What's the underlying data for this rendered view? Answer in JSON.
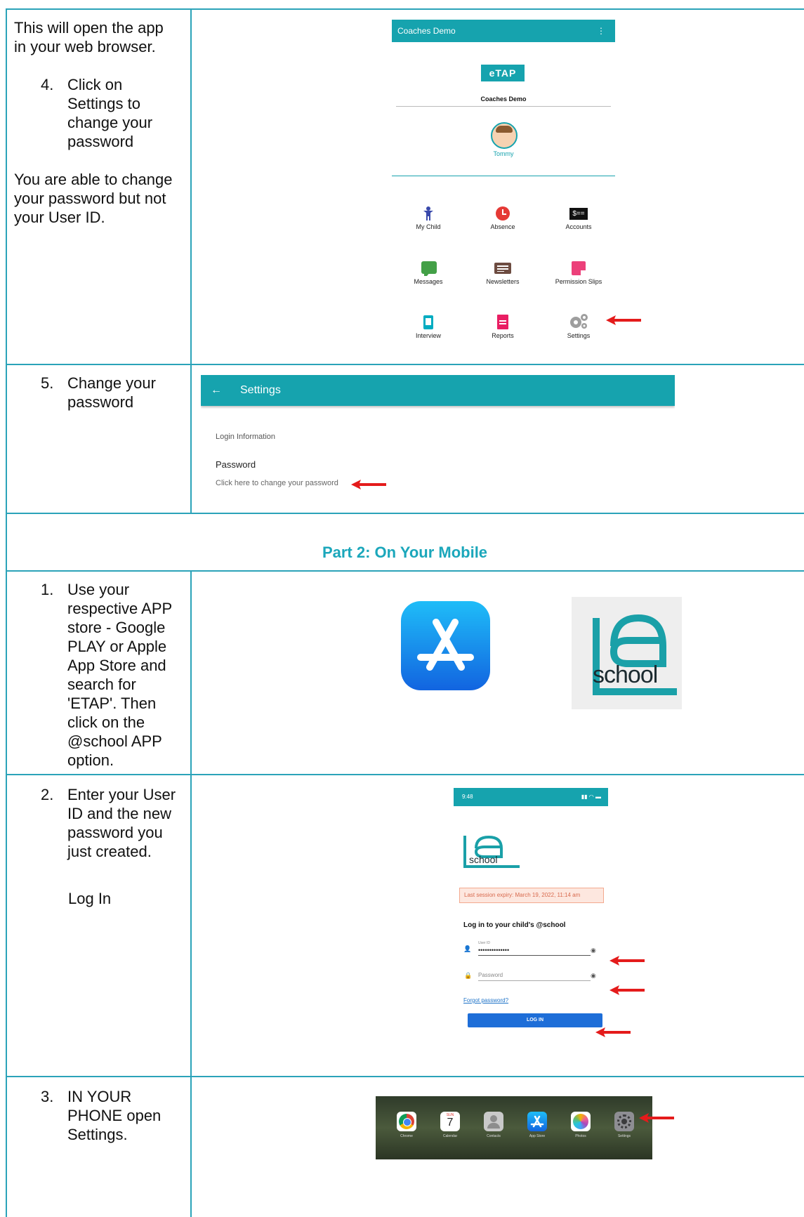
{
  "row1": {
    "intro": "This will open the app in your web browser.",
    "step_number": "4.",
    "step_text": "Click on Settings to change your password",
    "note": "You are able to change your password but not your User ID.",
    "app": {
      "header_title": "Coaches Demo",
      "menu_glyph": "⋮",
      "logo_text": "eTAP",
      "school_name": "Coaches Demo",
      "child_name": "Tommy",
      "tiles": [
        {
          "label": "My Child",
          "icon": "child-icon",
          "color": "#3949ab"
        },
        {
          "label": "Absence",
          "icon": "clock-icon",
          "color": "#e53935"
        },
        {
          "label": "Accounts",
          "icon": "money-icon",
          "color": "#111111"
        },
        {
          "label": "Messages",
          "icon": "chat-icon",
          "color": "#43a047"
        },
        {
          "label": "Newsletters",
          "icon": "newspaper-icon",
          "color": "#6d4c41"
        },
        {
          "label": "Permission Slips",
          "icon": "note-icon",
          "color": "#ec407a"
        },
        {
          "label": "Interview",
          "icon": "tablet-icon",
          "color": "#00acc1"
        },
        {
          "label": "Reports",
          "icon": "document-icon",
          "color": "#e91e63"
        },
        {
          "label": "Settings",
          "icon": "gears-icon",
          "color": "#9e9e9e"
        }
      ]
    }
  },
  "row2": {
    "step_number": "5.",
    "step_text": "Change your password",
    "settings": {
      "back_glyph": "←",
      "title": "Settings",
      "section": "Login Information",
      "password_label": "Password",
      "password_hint": "Click here to change your password"
    }
  },
  "part2": {
    "title": "Part 2: On Your Mobile"
  },
  "row3": {
    "step_number": "1.",
    "step_text": "Use your respective APP store - Google PLAY or Apple App Store and search for 'ETAP'. Then click on the @school APP option.",
    "school_logo_text": "school"
  },
  "row4": {
    "step_number": "2.",
    "step_text": "Enter your User ID and the new password you just created.",
    "step_text2": "Log In",
    "login": {
      "time": "9:48",
      "school_logo_text": "school",
      "expiry": "Last session expiry: March 19, 2022, 11:14 am",
      "heading": "Log in to your child's @school",
      "userid_label": "User ID",
      "userid_value": "••••••••••••••",
      "password_placeholder": "Password",
      "forgot": "Forgot password?",
      "login_button": "LOG IN"
    }
  },
  "row5": {
    "step_number": "3.",
    "step_text": "IN YOUR PHONE open Settings.",
    "dock": [
      {
        "label": "Chrome",
        "icon": "chrome-icon"
      },
      {
        "label": "Calendar",
        "icon": "calendar-icon",
        "day": "SUN",
        "date": "7"
      },
      {
        "label": "Contacts",
        "icon": "contacts-icon"
      },
      {
        "label": "App Store",
        "icon": "app-store-icon"
      },
      {
        "label": "Photos",
        "icon": "photos-icon"
      },
      {
        "label": "Settings",
        "icon": "settings-icon"
      }
    ]
  }
}
